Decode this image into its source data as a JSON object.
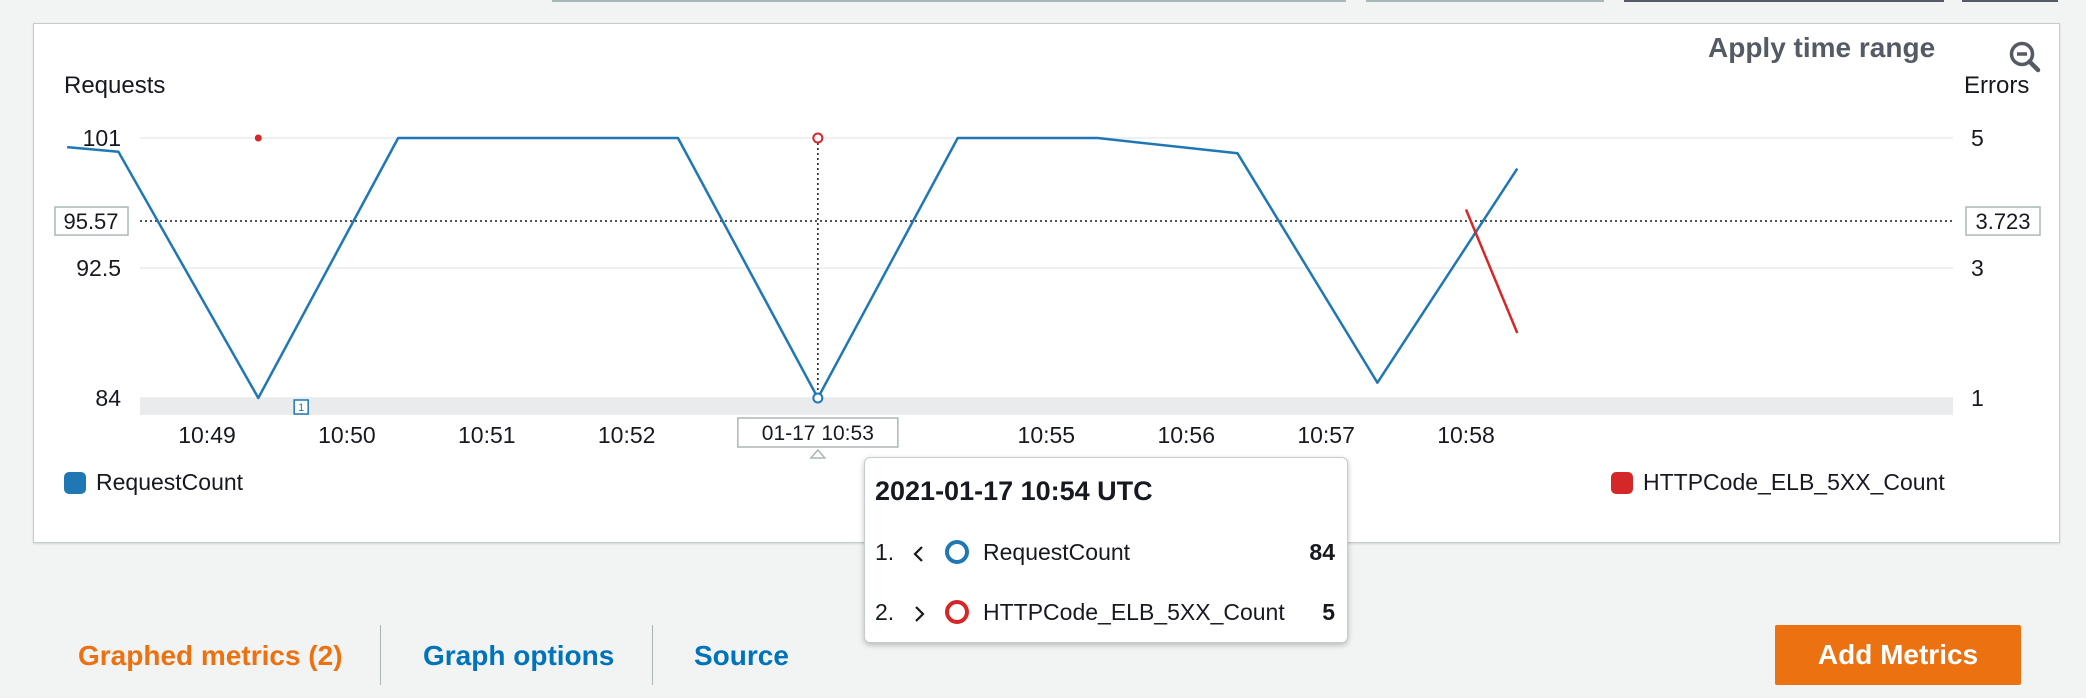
{
  "colors": {
    "request_series": "#1f77b4",
    "errors_series": "#d62728",
    "active_tab": "#ec7211",
    "link_tab": "#0073bb",
    "primary_button": "#ec7211"
  },
  "header": {
    "apply_time_range": "Apply time range",
    "zoom_icon": "zoom-out-icon"
  },
  "chart_data": {
    "type": "line",
    "x": [
      "10:48:40",
      "10:48:55",
      "10:49:15",
      "10:49:35",
      "10:49:55",
      "10:50:15",
      "10:50:35",
      "10:50:55",
      "10:51:15",
      "10:51:35",
      "10:51:55",
      "10:52:15",
      "10:52:35",
      "10:52:55",
      "10:53:15",
      "10:53:35",
      "10:53:55",
      "10:54:15",
      "10:54:35",
      "10:54:55",
      "10:55:15",
      "10:55:35",
      "10:55:55",
      "10:56:15",
      "10:56:35",
      "10:56:55",
      "10:57:15",
      "10:57:35",
      "10:57:55",
      "10:58:15",
      "10:58:35",
      "10:58:55"
    ],
    "x_ticks": [
      "10:49",
      "10:50",
      "10:51",
      "10:52",
      "10:53",
      "10:54",
      "10:55",
      "10:56",
      "10:57",
      "10:58"
    ],
    "left_axis": {
      "label": "Requests",
      "ticks": [
        101,
        92.5,
        84
      ],
      "ylim": [
        84,
        101
      ]
    },
    "right_axis": {
      "label": "Errors",
      "ticks": [
        5,
        3,
        1
      ],
      "ylim": [
        1,
        5
      ]
    },
    "series": [
      {
        "name": "RequestCount",
        "axis": "left",
        "points": [
          [
            "10:48:00",
            100.4
          ],
          [
            "10:48:22",
            100.1
          ],
          [
            "10:49:22",
            84
          ],
          [
            "10:50:22",
            101
          ],
          [
            "10:51:22",
            101
          ],
          [
            "10:52:22",
            101
          ],
          [
            "10:53:22",
            84
          ],
          [
            "10:54:22",
            101
          ],
          [
            "10:55:22",
            101
          ],
          [
            "10:56:22",
            100
          ],
          [
            "10:57:22",
            85
          ],
          [
            "10:58:22",
            99
          ]
        ]
      },
      {
        "name": "HTTPCode_ELB_5XX_Count",
        "axis": "right",
        "points": [
          [
            "10:49:22",
            5
          ],
          [
            "10:53:22",
            5
          ],
          [
            "10:58:00",
            3.9
          ],
          [
            "10:58:22",
            2
          ]
        ]
      }
    ],
    "reference_line": {
      "left_value": "95.57",
      "right_value": "3.723"
    },
    "hover_x_label": "01-17 10:53",
    "annotation_marker": "1",
    "grid": true,
    "legend": {
      "left": "RequestCount",
      "right": "HTTPCode_ELB_5XX_Count"
    }
  },
  "tooltip": {
    "title": "2021-01-17 10:54 UTC",
    "rows": [
      {
        "index": "1.",
        "chevron": "<",
        "name": "RequestCount",
        "value": "84"
      },
      {
        "index": "2.",
        "chevron": ">",
        "name": "HTTPCode_ELB_5XX_Count",
        "value": "5"
      }
    ]
  },
  "bottom_tabs": {
    "graphed_metrics": "Graphed metrics (2)",
    "graph_options": "Graph options",
    "source": "Source",
    "add_metrics": "Add Metrics"
  }
}
